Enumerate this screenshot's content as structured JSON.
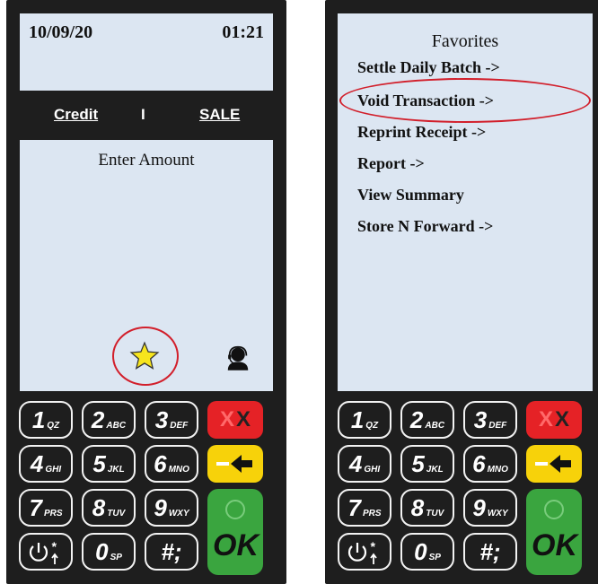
{
  "left": {
    "date": "10/09/20",
    "time": "01:21",
    "mode_card": "Credit",
    "mode_separator": "I",
    "mode_type": "SALE",
    "prompt": "Enter Amount",
    "favorites_icon": "star-icon",
    "support_icon": "headset-icon"
  },
  "right": {
    "title": "Favorites",
    "items": [
      "Settle Daily Batch ->",
      "Void Transaction ->",
      "Reprint Receipt ->",
      "Report ->",
      "View Summary",
      "Store N Forward ->"
    ],
    "highlighted_item": "Void Transaction ->"
  },
  "keypad": {
    "keys": [
      {
        "digit": "1",
        "letters": "QZ"
      },
      {
        "digit": "2",
        "letters": "ABC"
      },
      {
        "digit": "3",
        "letters": "DEF"
      },
      {
        "digit": "4",
        "letters": "GHI"
      },
      {
        "digit": "5",
        "letters": "JKL"
      },
      {
        "digit": "6",
        "letters": "MNO"
      },
      {
        "digit": "7",
        "letters": "PRS"
      },
      {
        "digit": "8",
        "letters": "TUV"
      },
      {
        "digit": "9",
        "letters": "WXY"
      },
      {
        "digit": "0",
        "letters": "SP"
      }
    ],
    "hash_label": "#;",
    "cancel_label": "X",
    "ok_label": "OK"
  },
  "colors": {
    "cancel": "#e52226",
    "clear": "#f7d20a",
    "enter": "#3aa53f",
    "screen": "#dce6f2",
    "highlight_ring": "#d21f2b"
  }
}
